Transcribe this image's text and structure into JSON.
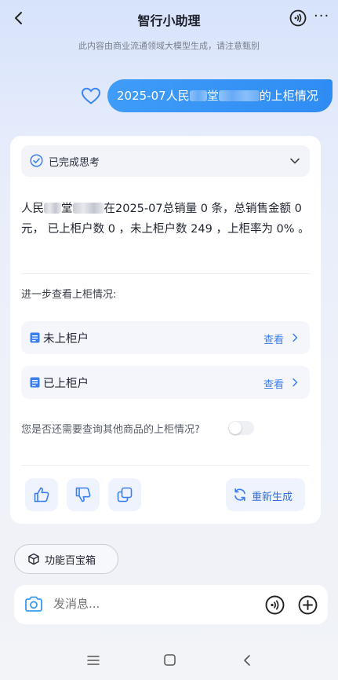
{
  "header": {
    "title": "智行小助理",
    "disclaimer": "此内容由商业流通领域大模型生成，请注意甄别",
    "more_glyph": "···"
  },
  "query": {
    "text_prefix": "2025-07人民",
    "text_mid": "堂",
    "text_suffix": "的上柜情况"
  },
  "thinking": {
    "label": "已完成思考"
  },
  "answer": {
    "p1_prefix": "人民",
    "p1_mid": "堂",
    "p1_rest": "在2025-07总销量 0 条，总销售金额 0 元， 已上柜户数 0 ，未上柜户数 249 ，上柜率为 0% 。"
  },
  "further": {
    "title": "进一步查看上柜情况:",
    "rows": [
      {
        "label": "未上柜户",
        "link": "查看"
      },
      {
        "label": "已上柜户",
        "link": "查看"
      }
    ]
  },
  "ask_more": {
    "text": "您是否还需要查询其他商品的上柜情况?",
    "toggle_on": false
  },
  "actions": {
    "regenerate": "重新生成"
  },
  "toolbox": {
    "label": "功能百宝箱"
  },
  "composer": {
    "placeholder": "发消息..."
  },
  "colors": {
    "accent": "#3a7ff0",
    "bubble": "#3492f6"
  }
}
